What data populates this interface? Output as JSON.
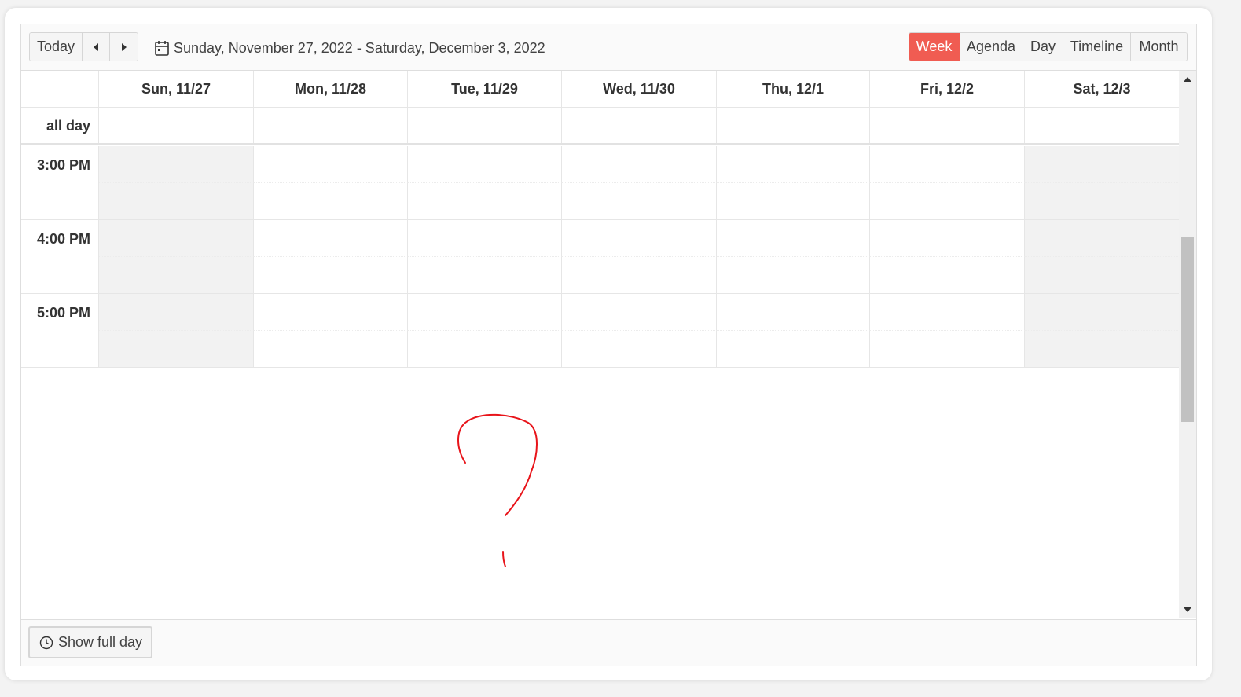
{
  "toolbar": {
    "today_label": "Today",
    "prev_icon": "caret-left-icon",
    "next_icon": "caret-right-icon",
    "date_range": "Sunday, November 27, 2022 - Saturday, December 3, 2022",
    "views": [
      {
        "label": "Week",
        "selected": true
      },
      {
        "label": "Agenda",
        "selected": false
      },
      {
        "label": "Day",
        "selected": false
      },
      {
        "label": "Timeline",
        "selected": false
      },
      {
        "label": "Month",
        "selected": false
      }
    ]
  },
  "days": [
    "Sun, 11/27",
    "Mon, 11/28",
    "Tue, 11/29",
    "Wed, 11/30",
    "Thu, 12/1",
    "Fri, 12/2",
    "Sat, 12/3"
  ],
  "all_day_label": "all day",
  "time_slots": [
    "3:00 PM",
    "4:00 PM",
    "5:00 PM"
  ],
  "footer": {
    "show_full_day_label": "Show full day"
  },
  "colors": {
    "accent": "#f05c52",
    "weekend_bg": "#f2f2f2",
    "annotation": "#e8141a"
  }
}
